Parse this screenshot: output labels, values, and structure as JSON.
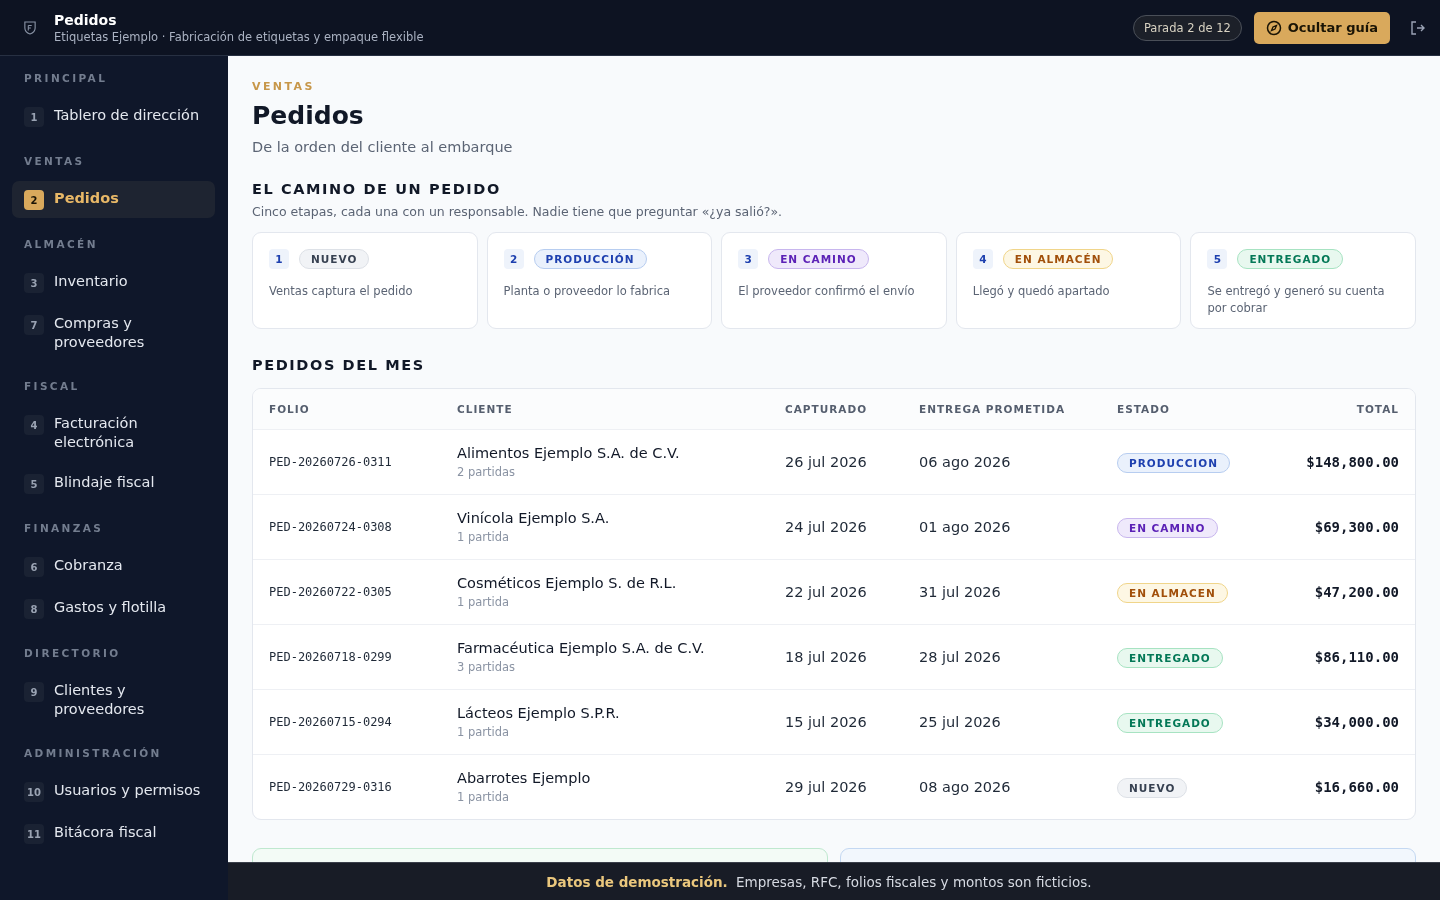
{
  "header": {
    "title": "Pedidos",
    "subtitle": "Etiquetas Ejemplo · Fabricación de etiquetas y empaque flexible",
    "tour_step": "Parada 2 de 12",
    "guide_button": "Ocultar guía"
  },
  "sidebar": {
    "sections": [
      {
        "title": "PRINCIPAL",
        "items": [
          {
            "number": "1",
            "label": "Tablero de dirección",
            "selected": false
          }
        ]
      },
      {
        "title": "VENTAS",
        "items": [
          {
            "number": "2",
            "label": "Pedidos",
            "selected": true
          }
        ]
      },
      {
        "title": "ALMACÉN",
        "items": [
          {
            "number": "3",
            "label": "Inventario",
            "selected": false
          },
          {
            "number": "7",
            "label": "Compras y proveedores",
            "selected": false
          }
        ]
      },
      {
        "title": "FISCAL",
        "items": [
          {
            "number": "4",
            "label": "Facturación electrónica",
            "selected": false
          },
          {
            "number": "5",
            "label": "Blindaje fiscal",
            "selected": false
          }
        ]
      },
      {
        "title": "FINANZAS",
        "items": [
          {
            "number": "6",
            "label": "Cobranza",
            "selected": false
          },
          {
            "number": "8",
            "label": "Gastos y flotilla",
            "selected": false
          }
        ]
      },
      {
        "title": "DIRECTORIO",
        "items": [
          {
            "number": "9",
            "label": "Clientes y proveedores",
            "selected": false
          }
        ]
      },
      {
        "title": "ADMINISTRACIÓN",
        "items": [
          {
            "number": "10",
            "label": "Usuarios y permisos",
            "selected": false
          },
          {
            "number": "11",
            "label": "Bitácora fiscal",
            "selected": false
          }
        ]
      }
    ]
  },
  "page": {
    "eyebrow": "VENTAS",
    "title": "Pedidos",
    "subtitle": "De la orden del cliente al embarque"
  },
  "flow": {
    "title": "EL CAMINO DE UN PEDIDO",
    "description": "Cinco etapas, cada una con un responsable. Nadie tiene que preguntar «¿ya salió?».",
    "steps": [
      {
        "number": "1",
        "status": "NUEVO",
        "kind": "nuevo",
        "text": "Ventas captura el pedido"
      },
      {
        "number": "2",
        "status": "PRODUCCIÓN",
        "kind": "produccion",
        "text": "Planta o proveedor lo fabrica"
      },
      {
        "number": "3",
        "status": "EN CAMINO",
        "kind": "camino",
        "text": "El proveedor confirmó el envío"
      },
      {
        "number": "4",
        "status": "EN ALMACÉN",
        "kind": "almacen",
        "text": "Llegó y quedó apartado"
      },
      {
        "number": "5",
        "status": "ENTREGADO",
        "kind": "entregado",
        "text": "Se entregó y generó su cuenta por cobrar"
      }
    ]
  },
  "orders": {
    "title": "PEDIDOS DEL MES",
    "columns": [
      "FOLIO",
      "CLIENTE",
      "CAPTURADO",
      "ENTREGA PROMETIDA",
      "ESTADO",
      "TOTAL"
    ],
    "rows": [
      {
        "folio": "PED-20260726-0311",
        "client": "Alimentos Ejemplo S.A. de C.V.",
        "items": "2 partidas",
        "captured": "26 jul 2026",
        "promised": "06 ago 2026",
        "status": "PRODUCCION",
        "kind": "produccion",
        "total": "$148,800.00"
      },
      {
        "folio": "PED-20260724-0308",
        "client": "Vinícola Ejemplo S.A.",
        "items": "1 partida",
        "captured": "24 jul 2026",
        "promised": "01 ago 2026",
        "status": "EN CAMINO",
        "kind": "camino",
        "total": "$69,300.00"
      },
      {
        "folio": "PED-20260722-0305",
        "client": "Cosméticos Ejemplo S. de R.L.",
        "items": "1 partida",
        "captured": "22 jul 2026",
        "promised": "31 jul 2026",
        "status": "EN ALMACEN",
        "kind": "almacen",
        "total": "$47,200.00"
      },
      {
        "folio": "PED-20260718-0299",
        "client": "Farmacéutica Ejemplo S.A. de C.V.",
        "items": "3 partidas",
        "captured": "18 jul 2026",
        "promised": "28 jul 2026",
        "status": "ENTREGADO",
        "kind": "entregado",
        "total": "$86,110.00"
      },
      {
        "folio": "PED-20260715-0294",
        "client": "Lácteos Ejemplo S.P.R.",
        "items": "1 partida",
        "captured": "15 jul 2026",
        "promised": "25 jul 2026",
        "status": "ENTREGADO",
        "kind": "entregado",
        "total": "$34,000.00"
      },
      {
        "folio": "PED-20260729-0316",
        "client": "Abarrotes Ejemplo",
        "items": "1 partida",
        "captured": "29 jul 2026",
        "promised": "08 ago 2026",
        "status": "NUEVO",
        "kind": "nuevo",
        "total": "$16,660.00"
      }
    ]
  },
  "demo_banner": {
    "text": "**Datos de demostración.** Empresas, RFC, folios fiscales y montos son ficticios."
  }
}
